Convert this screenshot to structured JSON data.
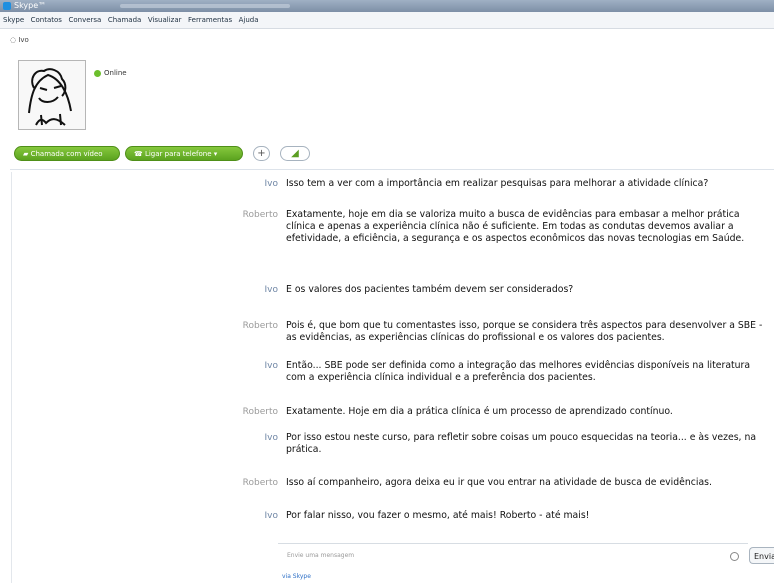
{
  "window": {
    "title": "Skype™"
  },
  "menu": [
    "Skype",
    "Contatos",
    "Conversa",
    "Chamada",
    "Visualizar",
    "Ferramentas",
    "Ajuda"
  ],
  "nav": {
    "back_label": "Ivo"
  },
  "profile": {
    "status": "Online",
    "buttons": {
      "video": "Chamada com vídeo",
      "phone": "Ligar para telefone"
    }
  },
  "messages": [
    {
      "author": "Ivo",
      "text": "Isso tem a ver com a importância em realizar pesquisas para melhorar a atividade clínica?"
    },
    {
      "author": "Roberto",
      "text": "Exatamente, hoje em dia se valoriza muito a busca de evidências para embasar a melhor prática clínica e apenas a experiência clínica não é suficiente. Em todas as condutas devemos avaliar a efetividade, a eficiência, a segurança e os aspectos econômicos das novas tecnologias em Saúde."
    },
    {
      "author": "Ivo",
      "text": "E os valores dos pacientes também devem ser considerados?"
    },
    {
      "author": "Roberto",
      "text": "Pois é, que bom que tu comentastes isso, porque se considera três aspectos para desenvolver a SBE - as evidências, as experiências clínicas do profissional e os valores dos pacientes."
    },
    {
      "author": "Ivo",
      "text": "Então... SBE pode ser definida como a integração das melhores evidências disponíveis na literatura com a experiência clínica individual e a preferência dos pacientes."
    },
    {
      "author": "Roberto",
      "text": "Exatamente. Hoje em dia a prática clínica é um processo de aprendizado contínuo."
    },
    {
      "author": "Ivo",
      "text": "Por isso estou neste curso, para refletir sobre coisas um pouco esquecidas na teoria... e às vezes, na prática."
    },
    {
      "author": "Roberto",
      "text": "Isso aí companheiro, agora deixa eu ir que vou entrar na atividade de busca de evidências."
    },
    {
      "author": "Ivo",
      "text": "Por falar nisso, vou fazer o mesmo, até mais! Roberto - até mais!"
    }
  ],
  "compose": {
    "placeholder": "Envie uma mensagem",
    "send_label": "Envia"
  },
  "footer": {
    "link": "via Skype"
  }
}
